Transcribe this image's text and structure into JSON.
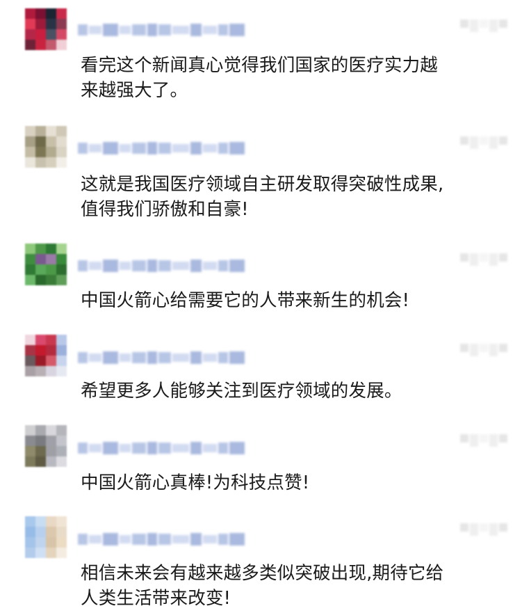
{
  "comments": [
    {
      "username_pixelated": true,
      "avatar_colors": [
        "#b01a3c",
        "#7a1032",
        "#1b2433",
        "#c92a4a",
        "#e03a56",
        "#9c1b3a",
        "#2a3346",
        "#8b3a52",
        "#b52749",
        "#c91e3f",
        "#4a5163",
        "#d44a66",
        "#6e2238",
        "#c82440",
        "#c35a6e",
        "#f0d0d6"
      ],
      "text": "看完这个新闻真心觉得我们国家的医疗实力越\n来越强大了。"
    },
    {
      "username_pixelated": true,
      "avatar_colors": [
        "#d8d0c0",
        "#b9b09a",
        "#e6e0d4",
        "#cfc8b6",
        "#a79f86",
        "#6e6a4a",
        "#c7bfa8",
        "#e2dccf",
        "#c4bca4",
        "#7d7654",
        "#b3ab90",
        "#d9d3c4",
        "#eae6dc",
        "#c8c1ad",
        "#d6cfbd",
        "#f2efe8"
      ],
      "text": "这就是我国医疗领域自主研发取得突破性成果,\n值得我们骄傲和自豪!"
    },
    {
      "username_pixelated": true,
      "avatar_colors": [
        "#8ec87a",
        "#4f9a4a",
        "#2e7a34",
        "#a4d48e",
        "#3f8e40",
        "#7a5a8e",
        "#9a7aa6",
        "#3a8a3c",
        "#2f7a34",
        "#5aa85a",
        "#4c9a48",
        "#2b6e2e",
        "#6cb86a",
        "#2a6a2c",
        "#3a7c38",
        "#5e9e58"
      ],
      "text": "中国火箭心给需要它的人带来新生的机会!"
    },
    {
      "username_pixelated": true,
      "avatar_colors": [
        "#f0d6de",
        "#d94a6e",
        "#c9384e",
        "#b8c8e8",
        "#a83446",
        "#c41a2e",
        "#b42a3e",
        "#9cb0dc",
        "#6a5a5e",
        "#9a1a28",
        "#d45a6a",
        "#c8d4ee",
        "#a8a0a4",
        "#b8b0b4",
        "#d8d4e0",
        "#e6e8f2"
      ],
      "text": "希望更多人能够关注到医疗领域的发展。"
    },
    {
      "username_pixelated": true,
      "avatar_colors": [
        "#cfcfd2",
        "#a9aab0",
        "#d8d8dc",
        "#b5b6bc",
        "#8a8b90",
        "#7a7b80",
        "#a0a1a8",
        "#c4c5cc",
        "#8e8a6a",
        "#6e6a50",
        "#9fa0a6",
        "#aeb0b8",
        "#7d7a5c",
        "#5e5a44",
        "#b8b9c0",
        "#dcdce0"
      ],
      "text": "中国火箭心真棒!为科技点赞!"
    },
    {
      "username_pixelated": true,
      "avatar_colors": [
        "#a8c8ec",
        "#c8dcf2",
        "#e8d8c4",
        "#f0e4d4",
        "#98bce8",
        "#b8d0ee",
        "#dcc8ac",
        "#e8dcc8",
        "#a4c4ea",
        "#c0d4ee",
        "#d8c4a8",
        "#ecdcc4",
        "#b4ccec",
        "#d0e0f4",
        "#e4d4bc",
        "#f4ece0"
      ],
      "text": "相信未来会有越来越多类似突破出现,期待它给\n人类生活带来改变!"
    }
  ]
}
